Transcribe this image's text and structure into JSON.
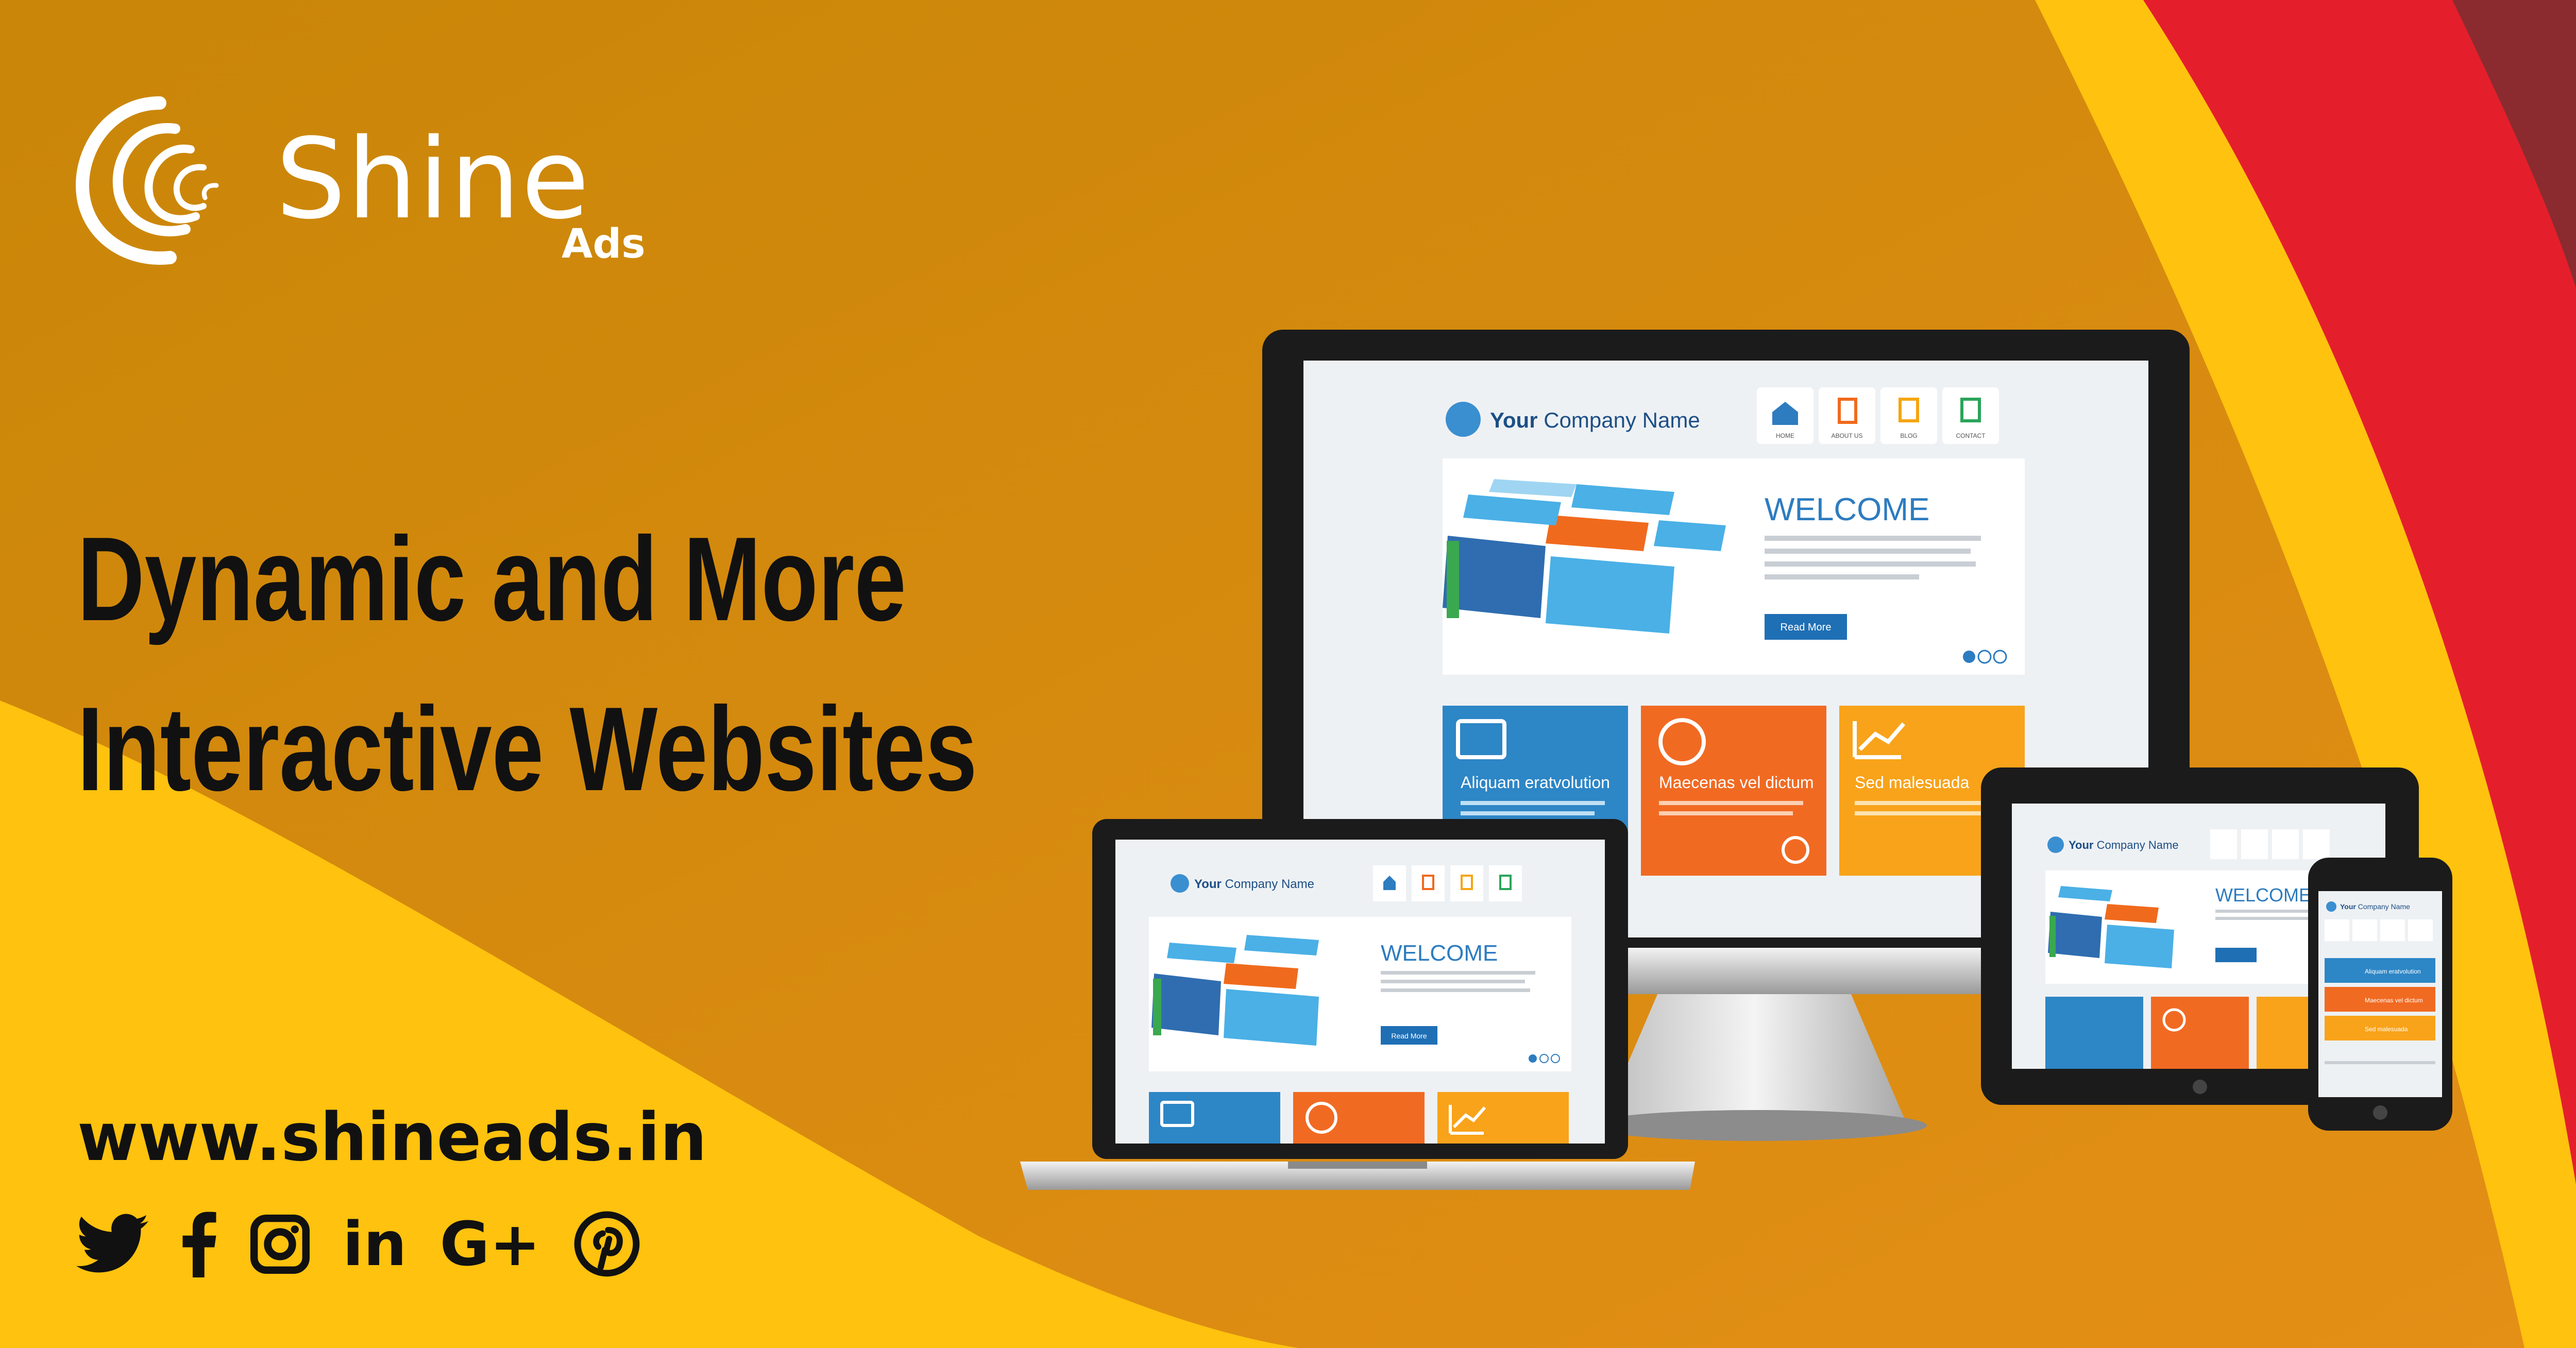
{
  "brand": {
    "name": "Shine",
    "sub": "Ads",
    "colors": {
      "orange": "#d98a10",
      "yellow": "#ffc20e",
      "red": "#e41f2b",
      "maroon": "#8b2b2f"
    }
  },
  "headline": {
    "line1": "Dynamic and More",
    "line2": "Interactive Websites"
  },
  "website": "www.shineads.in",
  "socials": [
    {
      "icon": "twitter-icon"
    },
    {
      "icon": "facebook-icon"
    },
    {
      "icon": "instagram-icon"
    },
    {
      "icon": "linkedin-icon",
      "label": "in"
    },
    {
      "icon": "google-plus-icon",
      "label": "G+"
    },
    {
      "icon": "pinterest-icon"
    }
  ],
  "mockup": {
    "company": "Your Company Name",
    "company_bold": "Your",
    "company_rest": "Company Name",
    "nav": [
      "HOME",
      "ABOUT US",
      "BLOG",
      "CONTACT"
    ],
    "welcome": "WELCOME",
    "button": "Read More",
    "tiles": [
      "Aliquam eratvolution",
      "Maecenas vel dictum",
      "Sed malesuada"
    ]
  }
}
